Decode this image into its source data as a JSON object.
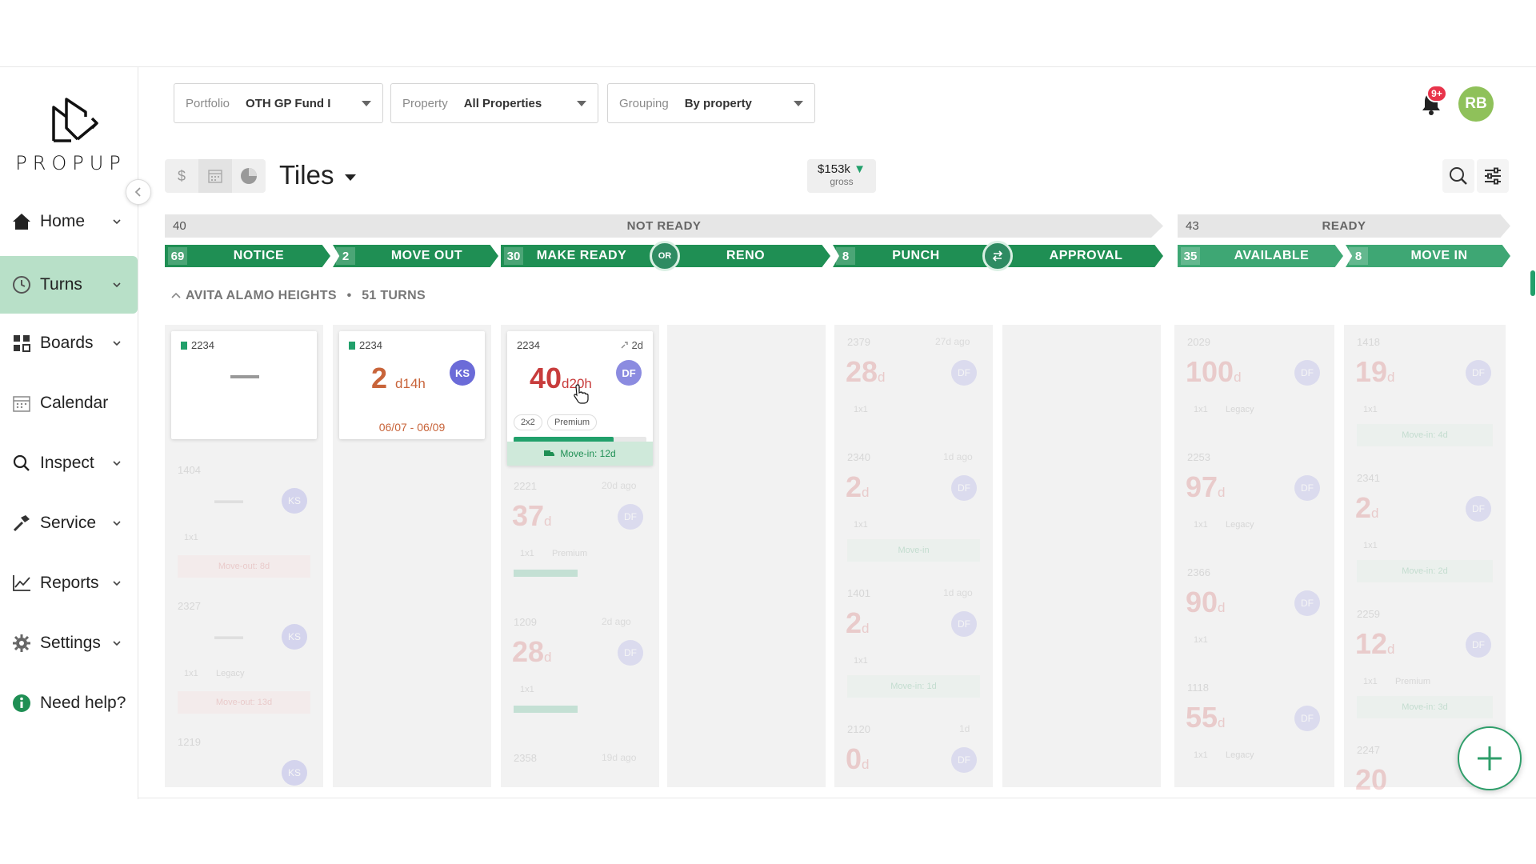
{
  "sidebar": {
    "logo_text": "PROPUP",
    "items": [
      {
        "label": "Home",
        "icon": "home-icon",
        "has_chevron": true
      },
      {
        "label": "Turns",
        "icon": "clock-icon",
        "has_chevron": true,
        "active": true
      },
      {
        "label": "Boards",
        "icon": "grid-icon",
        "has_chevron": true
      },
      {
        "label": "Calendar",
        "icon": "calendar-icon",
        "has_chevron": false
      },
      {
        "label": "Inspect",
        "icon": "search-icon",
        "has_chevron": true
      },
      {
        "label": "Service",
        "icon": "hammer-icon",
        "has_chevron": true
      },
      {
        "label": "Reports",
        "icon": "chart-line-icon",
        "has_chevron": true
      },
      {
        "label": "Settings",
        "icon": "gear-icon",
        "has_chevron": true
      },
      {
        "label": "Need help?",
        "icon": "info-icon",
        "has_chevron": false
      }
    ]
  },
  "filters": {
    "portfolio": {
      "label": "Portfolio",
      "value": "OTH GP Fund I"
    },
    "property": {
      "label": "Property",
      "value": "All Properties"
    },
    "grouping": {
      "label": "Grouping",
      "value": "By property"
    }
  },
  "header": {
    "notification_badge": "9+",
    "avatar_initials": "RB"
  },
  "toolbar": {
    "view_title": "Tiles",
    "dollar_symbol": "$",
    "gross_amount": "$153k",
    "gross_label": "gross"
  },
  "groups": {
    "not_ready": {
      "count": "40",
      "name": "NOT READY"
    },
    "ready": {
      "count": "43",
      "name": "READY"
    }
  },
  "stages": [
    {
      "count": "69",
      "name": "NOTICE"
    },
    {
      "count": "2",
      "name": "MOVE OUT"
    },
    {
      "count": "30",
      "name": "MAKE READY"
    },
    {
      "count": "",
      "name": "RENO"
    },
    {
      "count": "8",
      "name": "PUNCH"
    },
    {
      "count": "",
      "name": "APPROVAL"
    },
    {
      "count": "35",
      "name": "AVAILABLE"
    },
    {
      "count": "8",
      "name": "MOVE IN"
    }
  ],
  "connector_or": "OR",
  "group_section": {
    "name": "AVITA ALAMO HEIGHTS",
    "sep": "•",
    "turns": "51 TURNS"
  },
  "cards": {
    "notice": {
      "unit": "2234",
      "days": "—"
    },
    "move_out": {
      "unit": "2234",
      "days": "2",
      "suffix": "d14h",
      "initials": "KS",
      "date_range": "06/07 - 06/09"
    },
    "make_ready": {
      "unit": "2234",
      "ago": "2d",
      "days": "40",
      "suffix": "d20h",
      "initials": "DF",
      "tag1": "2x2",
      "tag2": "Premium",
      "progress": 0.75,
      "move_in": "Move-in: 12d"
    }
  },
  "ghost_cards": {
    "notice": [
      {
        "unit": "1404",
        "days": "—",
        "initials": "KS",
        "type": "1x1",
        "move": "Move-out: 8d"
      },
      {
        "unit": "2327",
        "days": "—",
        "initials": "KS",
        "type": "1x1",
        "extra": "Legacy",
        "move": "Move-out: 13d"
      },
      {
        "unit": "1219",
        "days": "",
        "initials": "KS",
        "type": ""
      }
    ],
    "make_ready": [
      {
        "unit": "2221",
        "ago": "20d ago",
        "days": "37",
        "initials": "DF",
        "type": "1x1",
        "extra": "Premium"
      },
      {
        "unit": "1209",
        "ago": "2d ago",
        "days": "28",
        "initials": "DF",
        "type": "1x1"
      },
      {
        "unit": "2358",
        "ago": "19d ago",
        "days": "",
        "initials": "DF",
        "type": ""
      }
    ],
    "punch": [
      {
        "unit": "2379",
        "ago": "27d ago",
        "days": "28",
        "initials": "DF",
        "type": "1x1"
      },
      {
        "unit": "2340",
        "ago": "1d ago",
        "days": "2",
        "initials": "DF",
        "type": "1x1",
        "move": "Move-in"
      },
      {
        "unit": "1401",
        "ago": "1d ago",
        "days": "2",
        "initials": "DF",
        "type": "1x1",
        "move": "Move-in: 1d"
      },
      {
        "unit": "2120",
        "ago": "1d",
        "days": "0",
        "initials": "DF",
        "type": ""
      }
    ],
    "available": [
      {
        "unit": "2029",
        "days": "100",
        "initials": "DF",
        "type": "1x1",
        "extra": "Legacy"
      },
      {
        "unit": "2253",
        "days": "97",
        "initials": "DF",
        "type": "1x1",
        "extra": "Legacy"
      },
      {
        "unit": "2366",
        "days": "90",
        "initials": "DF",
        "type": "1x1"
      },
      {
        "unit": "1118",
        "days": "55",
        "initials": "DF",
        "type": "1x1",
        "extra": "Legacy"
      }
    ],
    "move_in": [
      {
        "unit": "1418",
        "days": "19",
        "initials": "DF",
        "type": "1x1",
        "move": "Move-in: 4d"
      },
      {
        "unit": "2341",
        "days": "2",
        "initials": "DF",
        "type": "1x1",
        "move": "Move-in: 2d"
      },
      {
        "unit": "2259",
        "days": "12",
        "initials": "DF",
        "type": "1x1",
        "extra": "Premium",
        "move": "Move-in: 3d"
      },
      {
        "unit": "2247",
        "days": "20",
        "initials": "",
        "type": ""
      }
    ]
  },
  "colors": {
    "accent": "#1f8f54",
    "active_nav": "#b8e0c8",
    "days_orange": "#c8643a",
    "days_red": "#c83c3c",
    "ks": "#6b6bd8",
    "df": "#8b8be0"
  }
}
